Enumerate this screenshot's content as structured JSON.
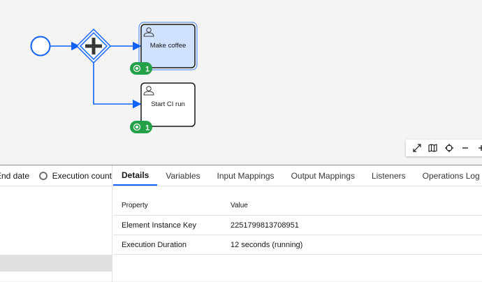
{
  "diagram": {
    "nodes": [
      {
        "id": "start",
        "type": "start-event"
      },
      {
        "id": "gateway",
        "type": "parallel-gateway"
      },
      {
        "id": "task1",
        "type": "user-task",
        "label": "Make coffee",
        "selected": true,
        "badge": "1"
      },
      {
        "id": "task2",
        "type": "user-task",
        "label": "Start CI run",
        "selected": false,
        "badge": "1"
      }
    ],
    "colors": {
      "flow": "#0f62fe",
      "selected_fill": "#d0e2ff",
      "badge": "#24a148"
    }
  },
  "toolbar": {
    "icons": [
      "maximize-icon",
      "map-icon",
      "crosshair-icon",
      "zoom-out-icon",
      "zoom-in-icon"
    ]
  },
  "left_panel": {
    "end_date_label": "End date",
    "execution_count_label": "Execution count"
  },
  "tabs": [
    "Details",
    "Variables",
    "Input Mappings",
    "Output Mappings",
    "Listeners",
    "Operations Log"
  ],
  "details": {
    "headers": {
      "property": "Property",
      "value": "Value"
    },
    "rows": [
      {
        "property": "Element Instance Key",
        "value": "2251799813708951"
      },
      {
        "property": "Execution Duration",
        "value": "12 seconds (running)"
      }
    ]
  }
}
